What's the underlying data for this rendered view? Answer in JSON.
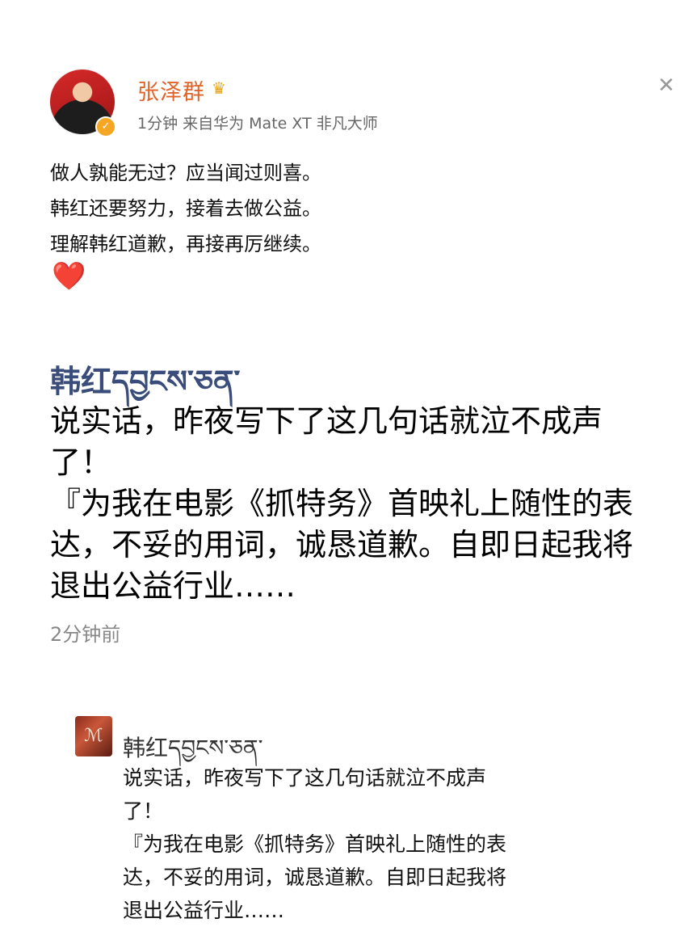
{
  "header": {
    "username": "张泽群",
    "meta": "1分钟  来自华为 Mate XT 非凡大师"
  },
  "post": {
    "lines": [
      "做人孰能无过？应当闻过则喜。",
      "韩红还要努力，接着去做公益。",
      "理解韩红道歉，再接再厉继续。"
    ],
    "emoji": "❤️"
  },
  "quote": {
    "name": "韩红དབྱངས་ཅན་",
    "lines": [
      "说实话，昨夜写下了这几句话就泣不成声",
      "了！",
      "『为我在电影《抓特务》首映礼上随性的表",
      "达，不妥的用词，诚恳道歉。自即日起我将",
      "退出公益行业……"
    ],
    "time": "2分钟前"
  },
  "embed": {
    "name": "韩红དབྱངས་ཅན་",
    "lines": [
      "说实话，昨夜写下了这几句话就泣不成声",
      "了！",
      "『为我在电影《抓特务》首映礼上随性的表",
      "达，不妥的用词，诚恳道歉。自即日起我将",
      "退出公益行业……"
    ]
  }
}
